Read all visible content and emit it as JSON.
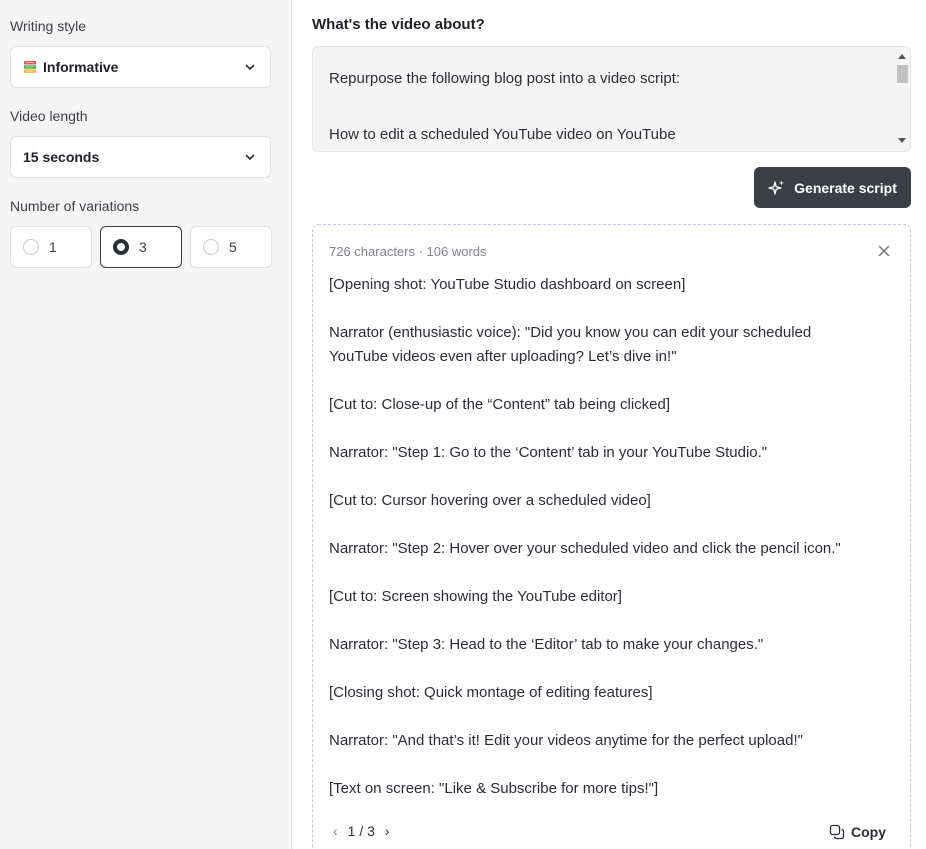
{
  "sidebar": {
    "writing_style": {
      "label": "Writing style",
      "value": "Informative",
      "icon": "books-icon"
    },
    "video_length": {
      "label": "Video length",
      "value": "15 seconds"
    },
    "variations": {
      "label": "Number of variations",
      "options": [
        "1",
        "3",
        "5"
      ],
      "selected": "3"
    }
  },
  "main": {
    "title": "What's the video about?",
    "prompt_text": "Repurpose the following blog post into a video script:\n\nHow to edit a scheduled YouTube video on YouTube\nEven after uploading and scheduling your YouTube video, you can still edit",
    "generate_label": "Generate script",
    "result": {
      "meta": "726 characters · 106 words",
      "lines": [
        "[Opening shot: YouTube Studio dashboard on screen]",
        "",
        "Narrator (enthusiastic voice): \"Did you know you can edit your scheduled",
        "YouTube videos even after uploading? Let’s dive in!\"",
        "",
        "[Cut to: Close-up of the “Content” tab being clicked]",
        "",
        "Narrator: \"Step 1: Go to the ‘Content’ tab in your YouTube Studio.\"",
        "",
        "[Cut to: Cursor hovering over a scheduled video]",
        "",
        "Narrator: \"Step 2: Hover over your scheduled video and click the pencil icon.\"",
        "",
        "[Cut to: Screen showing the YouTube editor]",
        "",
        "Narrator: \"Step 3: Head to the ‘Editor’ tab to make your changes.\"",
        "",
        "[Closing shot: Quick montage of editing features]",
        "",
        "Narrator: \"And that’s it! Edit your videos anytime for the perfect upload!\"",
        "",
        "[Text on screen: \"Like & Subscribe for more tips!\"]"
      ],
      "pager": "1 / 3",
      "copy_label": "Copy"
    }
  },
  "colors": {
    "button_bg": "#3b3e47",
    "sidebar_bg": "#f5f5f6",
    "dashed_border": "#c9c2e0"
  }
}
